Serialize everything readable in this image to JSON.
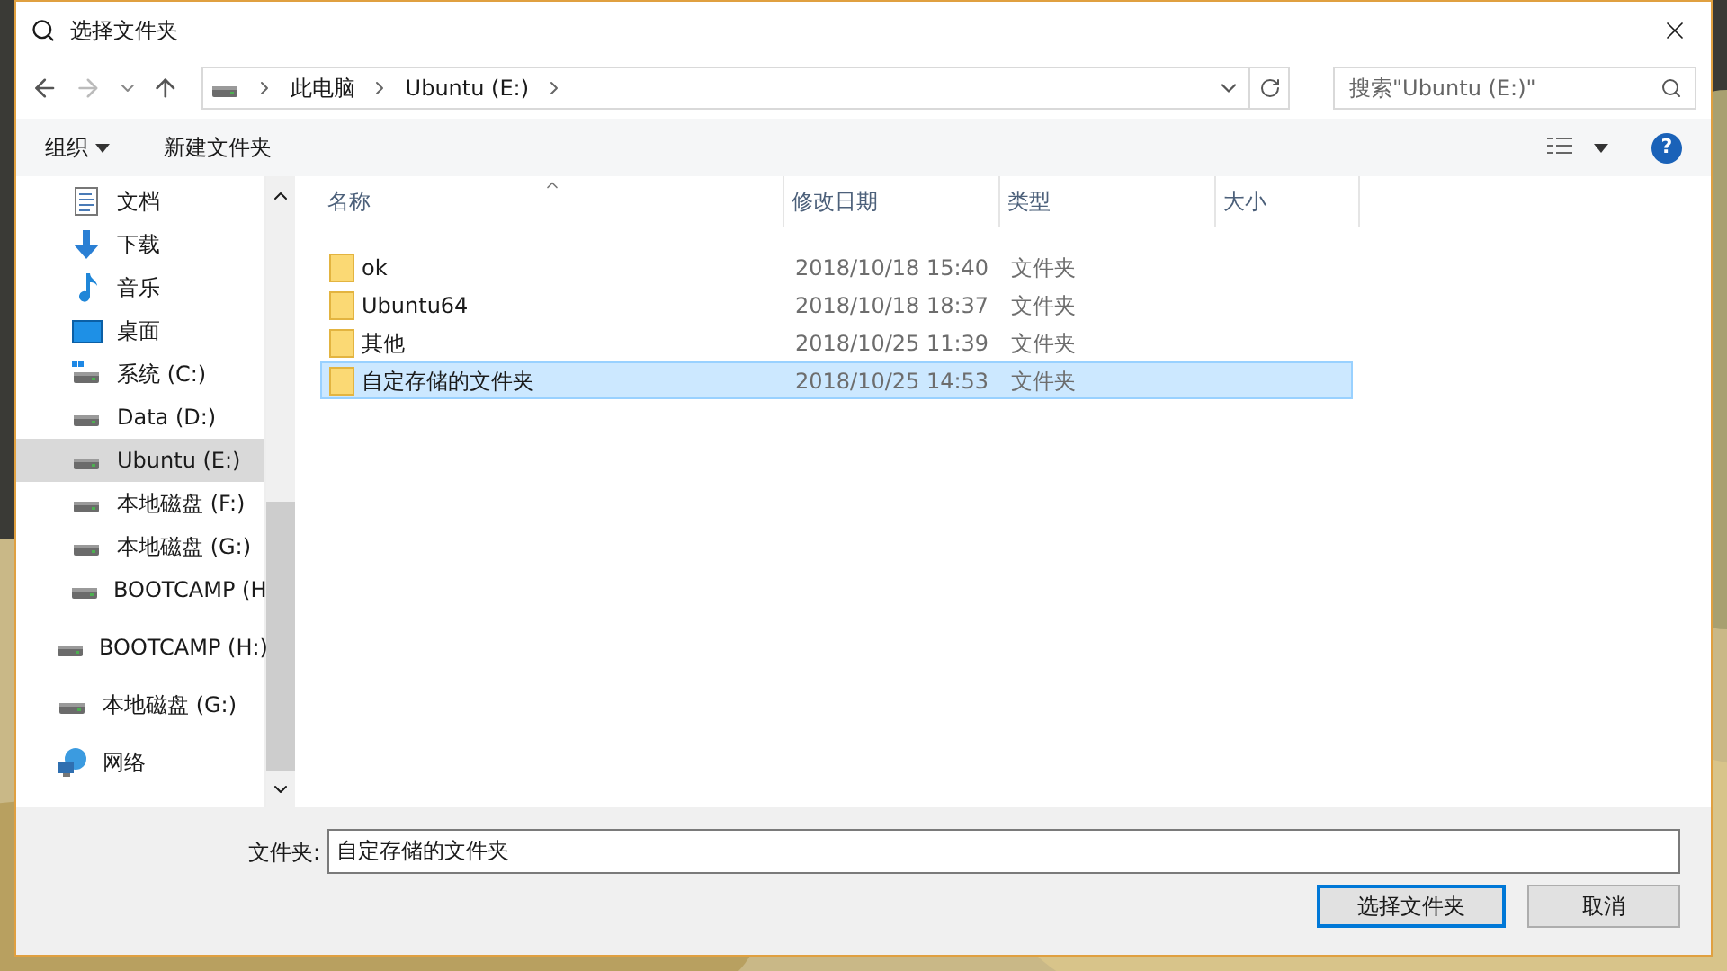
{
  "window": {
    "title": "选择文件夹"
  },
  "address": {
    "crumbs": [
      "此电脑",
      "Ubuntu (E:)"
    ]
  },
  "search": {
    "placeholder": "搜索\"Ubuntu (E:)\""
  },
  "toolbar": {
    "organize": "组织",
    "new_folder": "新建文件夹",
    "help": "?"
  },
  "sidebar": {
    "nested_items": [
      {
        "label": "文档",
        "kind": "document",
        "selected": false
      },
      {
        "label": "下载",
        "kind": "download",
        "selected": false
      },
      {
        "label": "音乐",
        "kind": "music",
        "selected": false
      },
      {
        "label": "桌面",
        "kind": "desktop",
        "selected": false
      },
      {
        "label": "系统 (C:)",
        "kind": "system-drive",
        "selected": false
      },
      {
        "label": "Data (D:)",
        "kind": "drive",
        "selected": false
      },
      {
        "label": "Ubuntu (E:)",
        "kind": "drive",
        "selected": true
      },
      {
        "label": "本地磁盘 (F:)",
        "kind": "drive",
        "selected": false
      },
      {
        "label": "本地磁盘 (G:)",
        "kind": "drive",
        "selected": false
      },
      {
        "label": "BOOTCAMP (H",
        "kind": "drive",
        "selected": false
      }
    ],
    "items": [
      {
        "label": "BOOTCAMP (H:)",
        "kind": "drive",
        "selected": false
      },
      {
        "label": "本地磁盘 (G:)",
        "kind": "drive",
        "selected": false
      },
      {
        "label": "网络",
        "kind": "network",
        "selected": false
      }
    ]
  },
  "table": {
    "columns": [
      "名称",
      "修改日期",
      "类型",
      "大小"
    ],
    "rows": [
      {
        "name": "ok",
        "modified": "2018/10/18 15:40",
        "type": "文件夹",
        "selected": false
      },
      {
        "name": "Ubuntu64",
        "modified": "2018/10/18 18:37",
        "type": "文件夹",
        "selected": false
      },
      {
        "name": "其他",
        "modified": "2018/10/25 11:39",
        "type": "文件夹",
        "selected": false
      },
      {
        "name": "自定存储的文件夹",
        "modified": "2018/10/25 14:53",
        "type": "文件夹",
        "selected": true
      }
    ]
  },
  "footer": {
    "field_label": "文件夹:",
    "field_value": "自定存储的文件夹",
    "buttons": [
      "选择文件夹",
      "取消"
    ]
  }
}
